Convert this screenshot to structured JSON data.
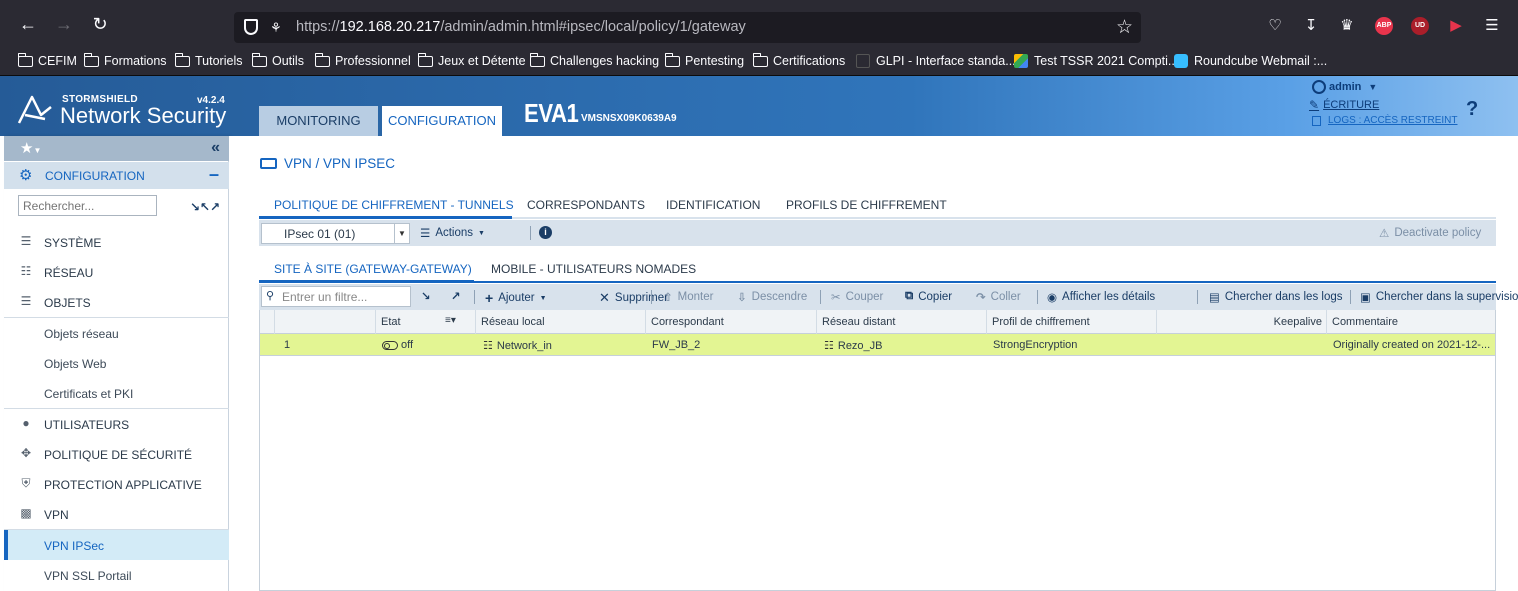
{
  "browser": {
    "url_prefix": "https://",
    "url_host": "192.168.20.217",
    "url_path": "/admin/admin.html#ipsec/local/policy/1/gateway",
    "ext_abp": "ABP",
    "ext_ud": "UD"
  },
  "bookmarks": [
    {
      "label": "CEFIM",
      "type": "folder"
    },
    {
      "label": "Formations",
      "type": "folder"
    },
    {
      "label": "Tutoriels",
      "type": "folder"
    },
    {
      "label": "Outils",
      "type": "folder"
    },
    {
      "label": "Professionnel",
      "type": "folder"
    },
    {
      "label": "Jeux et Détente",
      "type": "folder"
    },
    {
      "label": "Challenges hacking",
      "type": "folder"
    },
    {
      "label": "Pentesting",
      "type": "folder"
    },
    {
      "label": "Certifications",
      "type": "folder"
    },
    {
      "label": "GLPI - Interface standa...",
      "type": "link"
    },
    {
      "label": "Test TSSR 2021 Compti...",
      "type": "link"
    },
    {
      "label": "Roundcube Webmail :...",
      "type": "link"
    }
  ],
  "app": {
    "brand": "STORMSHIELD",
    "product": "Network Security",
    "version": "v4.2.4",
    "tab_monitoring": "MONITORING",
    "tab_configuration": "CONFIGURATION",
    "firewall_name": "EVA1",
    "firewall_serial": "VMSNSX09K0639A9",
    "user": "admin",
    "write_mode": "ÉCRITURE",
    "logs_access": "LOGS : ACCÈS RESTREINT",
    "help": "?"
  },
  "sidebar": {
    "config_label": "CONFIGURATION",
    "search_placeholder": "Rechercher...",
    "items": [
      {
        "label": "SYSTÈME"
      },
      {
        "label": "RÉSEAU"
      },
      {
        "label": "OBJETS"
      },
      {
        "label": "Objets réseau"
      },
      {
        "label": "Objets Web"
      },
      {
        "label": "Certificats et PKI"
      },
      {
        "label": "UTILISATEURS"
      },
      {
        "label": "POLITIQUE DE SÉCURITÉ"
      },
      {
        "label": "PROTECTION APPLICATIVE"
      },
      {
        "label": "VPN"
      },
      {
        "label": "VPN IPSec"
      },
      {
        "label": "VPN SSL Portail"
      }
    ]
  },
  "main": {
    "breadcrumb": "VPN / VPN IPSEC",
    "tabs": [
      {
        "label": "POLITIQUE DE CHIFFREMENT - TUNNELS"
      },
      {
        "label": "CORRESPONDANTS"
      },
      {
        "label": "IDENTIFICATION"
      },
      {
        "label": "PROFILS DE CHIFFREMENT"
      }
    ],
    "policy_select": "IPsec 01 (01)",
    "actions_label": "Actions",
    "deactivate_label": "Deactivate policy",
    "subtabs": [
      {
        "label": "SITE À SITE (GATEWAY-GATEWAY)"
      },
      {
        "label": "MOBILE - UTILISATEURS NOMADES"
      }
    ],
    "filter_placeholder": "Entrer un filtre...",
    "toolbar": {
      "add": "Ajouter",
      "delete": "Supprimer",
      "up": "Monter",
      "down": "Descendre",
      "cut": "Couper",
      "copy": "Copier",
      "paste": "Coller",
      "details": "Afficher les détails",
      "search_logs": "Chercher dans les logs",
      "search_supervision": "Chercher dans la supervision"
    },
    "table": {
      "columns": [
        "Etat",
        "Réseau local",
        "Correspondant",
        "Réseau distant",
        "Profil de chiffrement",
        "Keepalive",
        "Commentaire"
      ],
      "rows": [
        {
          "num": "1",
          "state": "off",
          "local": "Network_in",
          "peer": "FW_JB_2",
          "remote": "Rezo_JB",
          "profile": "StrongEncryption",
          "keepalive": "",
          "comment": "Originally created on 2021-12-..."
        }
      ]
    }
  }
}
